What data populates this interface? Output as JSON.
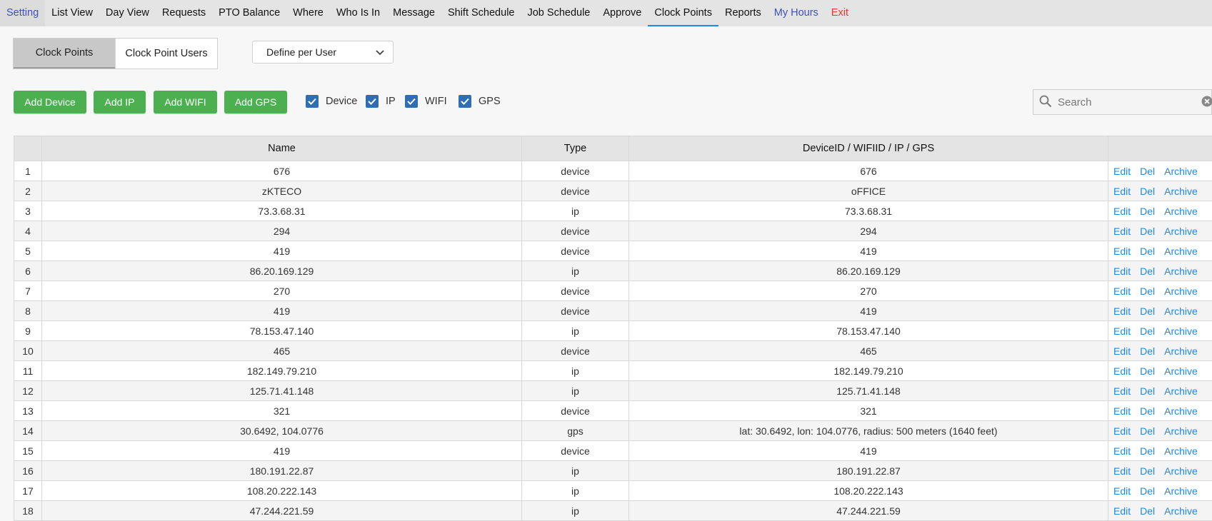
{
  "nav": {
    "items": [
      {
        "label": "Setting",
        "style": "first"
      },
      {
        "label": "List View",
        "style": ""
      },
      {
        "label": "Day View",
        "style": ""
      },
      {
        "label": "Requests",
        "style": ""
      },
      {
        "label": "PTO Balance",
        "style": ""
      },
      {
        "label": "Where",
        "style": ""
      },
      {
        "label": "Who Is In",
        "style": ""
      },
      {
        "label": "Message",
        "style": ""
      },
      {
        "label": "Shift Schedule",
        "style": ""
      },
      {
        "label": "Job Schedule",
        "style": ""
      },
      {
        "label": "Approve",
        "style": ""
      },
      {
        "label": "Clock Points",
        "style": "active"
      },
      {
        "label": "Reports",
        "style": ""
      },
      {
        "label": "My Hours",
        "style": "link"
      },
      {
        "label": "Exit",
        "style": "exit"
      }
    ]
  },
  "segment": {
    "clock_points": "Clock Points",
    "clock_point_users": "Clock Point Users"
  },
  "dropdown": {
    "selected": "Define per User",
    "icon": "chevron-down-icon"
  },
  "toolbar": {
    "add_device": "Add Device",
    "add_ip": "Add IP",
    "add_wifi": "Add WIFI",
    "add_gps": "Add GPS",
    "filters": {
      "device": {
        "label": "Device",
        "checked": true
      },
      "ip": {
        "label": "IP",
        "checked": true
      },
      "wifi": {
        "label": "WIFI",
        "checked": true
      },
      "gps": {
        "label": "GPS",
        "checked": true
      }
    }
  },
  "search": {
    "placeholder": "Search",
    "value": "",
    "icon": "search-icon",
    "clear_icon": "clear-icon"
  },
  "colors": {
    "green": "#4caf50",
    "link": "#1e88e5",
    "check": "#2f6db5",
    "exit": "#e53935",
    "nav_link": "#3f51b5"
  },
  "table": {
    "headers": {
      "num": "",
      "name": "Name",
      "type": "Type",
      "id": "DeviceID / WIFIID / IP / GPS",
      "actions": ""
    },
    "action_labels": {
      "edit": "Edit",
      "del": "Del",
      "archive": "Archive"
    },
    "rows": [
      {
        "num": "1",
        "name": "676",
        "type": "device",
        "id": "676"
      },
      {
        "num": "2",
        "name": "zKTECO",
        "type": "device",
        "id": "oFFICE"
      },
      {
        "num": "3",
        "name": "73.3.68.31",
        "type": "ip",
        "id": "73.3.68.31"
      },
      {
        "num": "4",
        "name": "294",
        "type": "device",
        "id": "294"
      },
      {
        "num": "5",
        "name": "419",
        "type": "device",
        "id": "419"
      },
      {
        "num": "6",
        "name": "86.20.169.129",
        "type": "ip",
        "id": "86.20.169.129"
      },
      {
        "num": "7",
        "name": "270",
        "type": "device",
        "id": "270"
      },
      {
        "num": "8",
        "name": "419",
        "type": "device",
        "id": "419"
      },
      {
        "num": "9",
        "name": "78.153.47.140",
        "type": "ip",
        "id": "78.153.47.140"
      },
      {
        "num": "10",
        "name": "465",
        "type": "device",
        "id": "465"
      },
      {
        "num": "11",
        "name": "182.149.79.210",
        "type": "ip",
        "id": "182.149.79.210"
      },
      {
        "num": "12",
        "name": "125.71.41.148",
        "type": "ip",
        "id": "125.71.41.148"
      },
      {
        "num": "13",
        "name": "321",
        "type": "device",
        "id": "321"
      },
      {
        "num": "14",
        "name": "30.6492, 104.0776",
        "type": "gps",
        "id": "lat: 30.6492, lon: 104.0776, radius: 500 meters (1640 feet)"
      },
      {
        "num": "15",
        "name": "419",
        "type": "device",
        "id": "419"
      },
      {
        "num": "16",
        "name": "180.191.22.87",
        "type": "ip",
        "id": "180.191.22.87"
      },
      {
        "num": "17",
        "name": "108.20.222.143",
        "type": "ip",
        "id": "108.20.222.143"
      },
      {
        "num": "18",
        "name": "47.244.221.59",
        "type": "ip",
        "id": "47.244.221.59"
      }
    ]
  }
}
